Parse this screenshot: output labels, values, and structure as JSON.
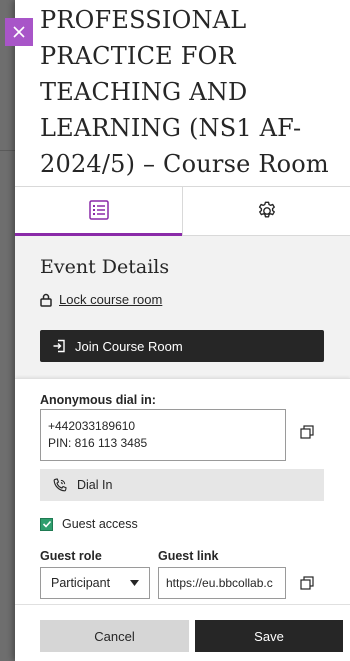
{
  "dialog": {
    "title": "PROFESSIONAL PRACTICE FOR TEACHING AND LEARNING (NS1 AF-2024/5) – Course Room"
  },
  "tabs": [
    {
      "icon": "list-icon",
      "active": true
    },
    {
      "icon": "gear-icon",
      "active": false
    }
  ],
  "event": {
    "heading": "Event Details",
    "lock_link": "Lock course room",
    "join_button": "Join Course Room"
  },
  "dial": {
    "label": "Anonymous dial in:",
    "phone": "+442033189610",
    "pin": "PIN: 816 113 3485",
    "dial_in_button": "Dial In"
  },
  "guest": {
    "access_label": "Guest access",
    "access_checked": true,
    "role_label": "Guest role",
    "role_value": "Participant",
    "link_label": "Guest link",
    "link_value": "https://eu.bbcollab.c"
  },
  "footer": {
    "cancel": "Cancel",
    "save": "Save"
  },
  "colors": {
    "accent": "#8a2aa8",
    "close_button": "#a855c8",
    "dark_button": "#262626",
    "checkbox": "#2f9e6e"
  }
}
